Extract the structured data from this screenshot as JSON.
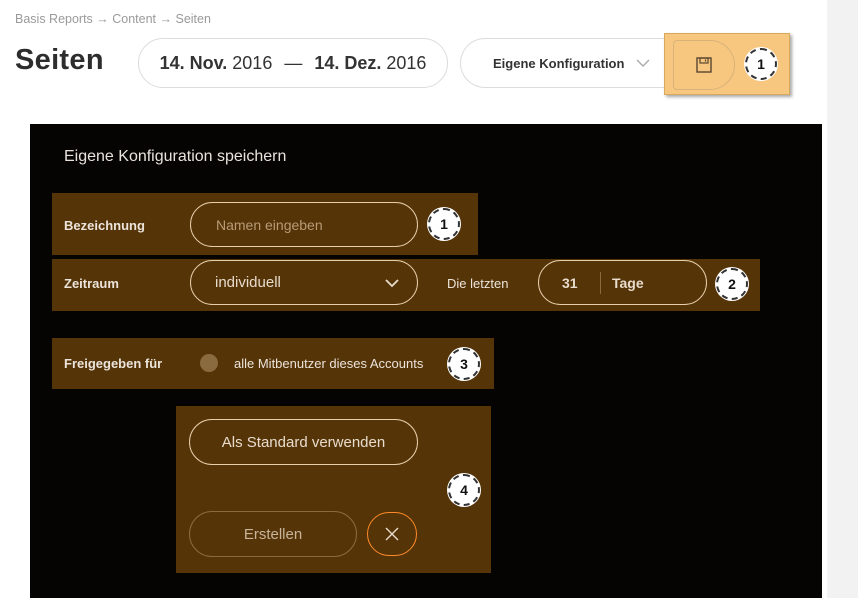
{
  "breadcrumb": "Basis Reports → Content → Seiten",
  "page_title": "Seiten",
  "date_range": {
    "start_bold": "14. Nov.",
    "start_year": "2016",
    "separator": "—",
    "end_bold": "14. Dez.",
    "end_year": "2016"
  },
  "config_select": {
    "label": "Eigene Konfiguration",
    "icon": "chevron-down-icon"
  },
  "save_button": {
    "icon": "floppy-disk-icon"
  },
  "badges": [
    "1",
    "1",
    "2",
    "3",
    "4"
  ],
  "modal": {
    "title": "Eigene Konfiguration speichern",
    "name_field": {
      "label": "Bezeichnung",
      "placeholder": "Namen eingeben"
    },
    "period": {
      "label": "Zeitraum",
      "selected": "individuell",
      "last_label": "Die letzten",
      "count": "31",
      "unit": "Tage"
    },
    "share": {
      "label": "Freigegeben für",
      "option": "alle Mitbenutzer dieses Accounts"
    },
    "default_button": "Als Standard verwenden",
    "create_button": "Erstellen"
  },
  "colors": {
    "highlight": "#f7c77f",
    "panel": "#553408",
    "modal_bg": "#060403",
    "accent_orange": "#ff8b28"
  }
}
